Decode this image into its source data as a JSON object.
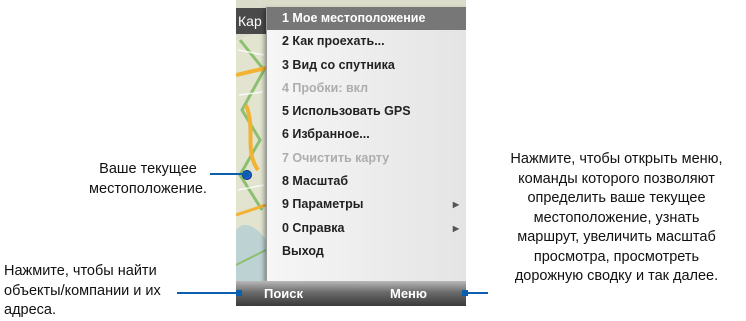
{
  "window": {
    "title_partial": "Кар"
  },
  "menu": {
    "items": [
      {
        "label": "1 Мое местоположение",
        "state": "selected",
        "has_submenu": false
      },
      {
        "label": "2 Как проехать...",
        "state": "normal",
        "has_submenu": false
      },
      {
        "label": "3 Вид со спутника",
        "state": "normal",
        "has_submenu": false
      },
      {
        "label": "4 Пробки: вкл",
        "state": "disabled",
        "has_submenu": false
      },
      {
        "label": "5 Использовать GPS",
        "state": "normal",
        "has_submenu": false
      },
      {
        "label": "6 Избранное...",
        "state": "normal",
        "has_submenu": false
      },
      {
        "label": "7 Очистить карту",
        "state": "disabled",
        "has_submenu": false
      },
      {
        "label": "8 Масштаб",
        "state": "normal",
        "has_submenu": false
      },
      {
        "label": "9 Параметры",
        "state": "normal",
        "has_submenu": true
      },
      {
        "label": "0 Справка",
        "state": "normal",
        "has_submenu": true
      },
      {
        "label": "Выход",
        "state": "normal",
        "has_submenu": false
      }
    ],
    "submenu_glyph": "▶"
  },
  "softkeys": {
    "left_label": "Поиск",
    "right_label": "Меню"
  },
  "captions": {
    "location": [
      "Ваше текущее",
      "местоположение."
    ],
    "search": [
      "Нажмите, чтобы найти",
      "объекты/компании и их",
      "адреса."
    ],
    "menu": [
      "Нажмите, чтобы открыть меню,",
      "команды которого позволяют",
      "определить ваше текущее",
      "местоположение, узнать",
      "маршрут, увеличить масштаб",
      "просмотра, просмотреть",
      "дорожную сводку и так далее."
    ]
  },
  "colors": {
    "menu_selected_bg": "#777777",
    "menu_disabled_text": "#adadad",
    "location_marker": "#1f5fd0",
    "road_yellow": "#f2b233",
    "road_green": "#8cc070",
    "map_water": "#9fc3d6"
  },
  "icons": {
    "location_marker": "blue-dot-icon",
    "submenu_arrow": "triangle-right-icon"
  }
}
